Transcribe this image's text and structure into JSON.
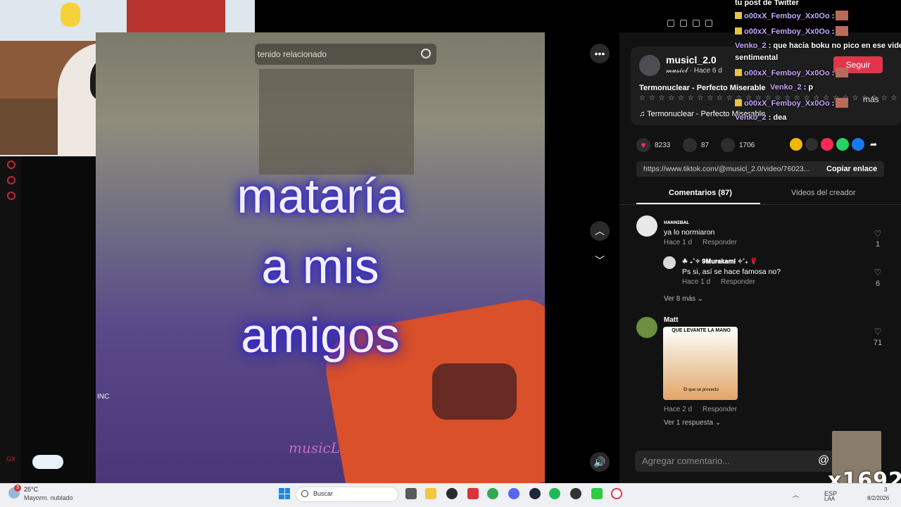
{
  "video": {
    "search_related": "tenido relacionado",
    "caption_lines": [
      "mataría",
      "a mis",
      "amigos"
    ],
    "watermark": "musicL",
    "small_logo": "INC"
  },
  "author": {
    "name": "musicl_2.0",
    "sub": "𝓶𝓾𝓼𝓲𝓬𝓵 · Hace 6 d",
    "follow": "Seguir",
    "song_title": "Termonuclear - Perfecto Miserable",
    "stars": "☆ ☆ ☆ ☆ ☆ ☆ ☆ ☆ ☆ ☆ ☆ ☆ ☆ ☆ ☆ ☆ ☆ ☆ ☆ ☆ ☆ ☆ ☆ ☆ ☆ ☆ ☆",
    "more": "más",
    "music": "♫  Termonuclear - Perfecto Miserable"
  },
  "stats": {
    "likes": "8233",
    "comments": "87",
    "saves": "1706"
  },
  "share": {
    "url": "https://www.tiktok.com/@musicl_2.0/video/76023...",
    "copy_label": "Copiar enlace"
  },
  "tabs": {
    "comments": "Comentarios (87)",
    "creator_videos": "Videos del creador"
  },
  "comments": [
    {
      "user": "ʜᴀɴɴɪʙᴀʟ",
      "text": "ya lo normiaron",
      "time": "Hace 1 d",
      "reply": "Responder",
      "likes": "1"
    },
    {
      "user": "☘ ₊˚✧ 𝟗𝐌𝐮𝐫𝐚𝐤𝐚𝐦𝐢 ✧˚₊ 🌹",
      "text": "Ps si, así se hace famosa no?",
      "time": "Hace 1 d",
      "reply": "Responder",
      "likes": "6"
    },
    {
      "user": "Matt",
      "text": "",
      "time": "Hace 2 d",
      "reply": "Responder",
      "likes": "71"
    }
  ],
  "more_replies_1": "Ver 8 más",
  "more_replies_2": "Ver 1 respuesta",
  "kitten": {
    "caption": "QUE LEVANTE LA MANO",
    "sub": "El que se provecto"
  },
  "comment_input": {
    "placeholder": "Agregar comentario..."
  },
  "at_symbol": "@",
  "chat": {
    "header": "tu post de Twitter",
    "lines": [
      {
        "name": "o00xX_Femboy_Xx0Oo",
        "text": ":"
      },
      {
        "name": "o00xX_Femboy_Xx0Oo",
        "text": ":"
      },
      {
        "name": "Venko_2",
        "text": ": que hacia boku no pico en ese video"
      },
      {
        "name": "",
        "text": "sentimental"
      },
      {
        "name": "o00xX_Femboy_Xx0Oo",
        "text": ":"
      },
      {
        "name": "Venko_2",
        "text": ": p"
      },
      {
        "name": "o00xX_Femboy_Xx0Oo",
        "text": ":"
      },
      {
        "name": "Venko_2",
        "text": ": dea"
      }
    ]
  },
  "overlay_number": "x1692",
  "taskbar": {
    "temp": "25°C",
    "weather": "Mayorm. nublado",
    "weather_badge": "3",
    "search": "Buscar",
    "lang1": "ESP",
    "lang2": "LAA",
    "date": "8/2/2026",
    "time": "3"
  }
}
